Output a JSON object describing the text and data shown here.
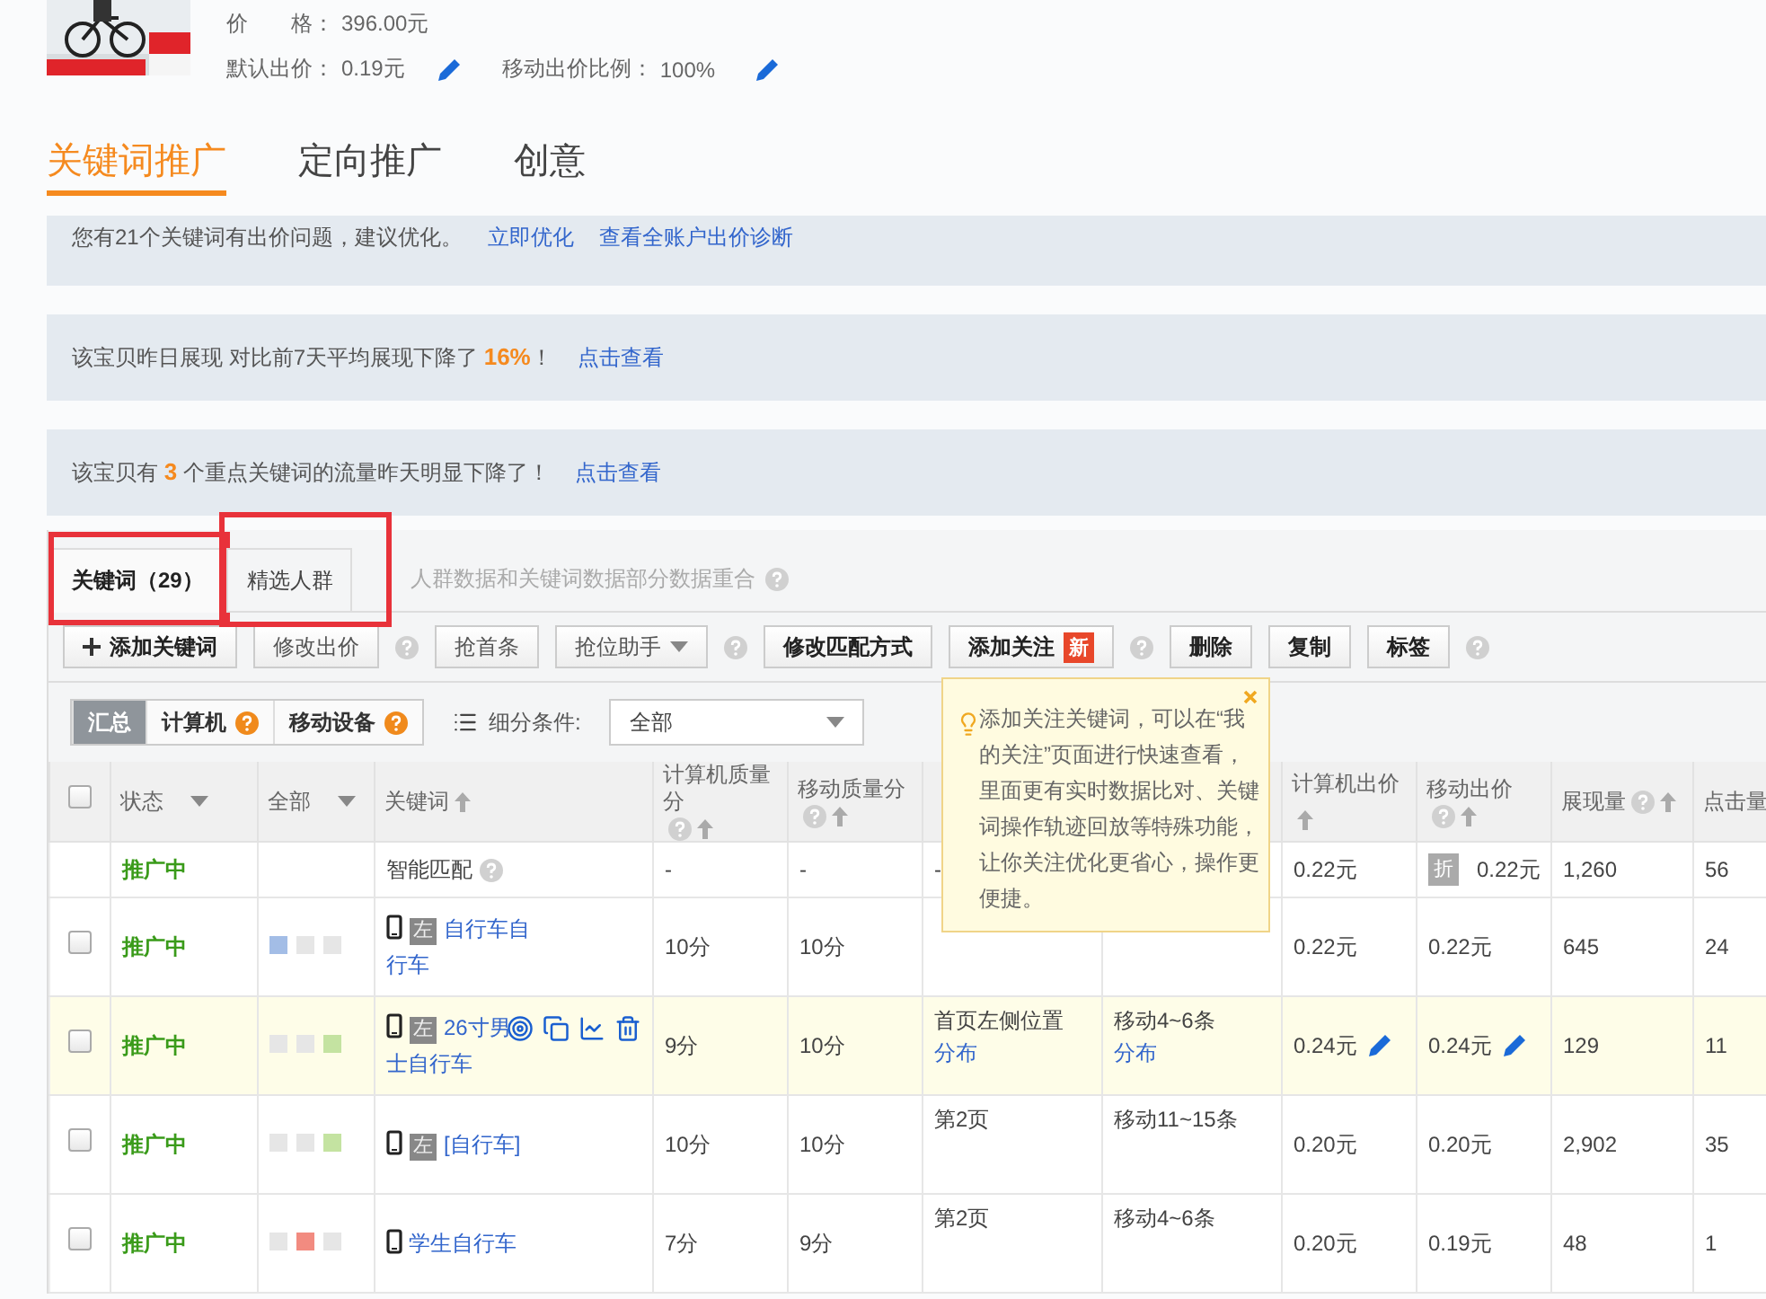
{
  "product": {
    "price_label": "价　　格：",
    "price": "396.00元",
    "default_bid_label": "默认出价：",
    "default_bid": "0.19元",
    "mobile_ratio_label": "移动出价比例：",
    "mobile_ratio": "100%"
  },
  "main_tabs": [
    {
      "label": "关键词推广",
      "selected": true
    },
    {
      "label": "定向推广",
      "selected": false
    },
    {
      "label": "创意",
      "selected": false
    }
  ],
  "notices": [
    {
      "text": "您有21个关键词有出价问题，建议优化。",
      "links": [
        "立即优化",
        "查看全账户出价诊断"
      ]
    },
    {
      "text": "该宝贝昨日展现 对比前7天平均展现下降了 **16%**！",
      "links": [
        "点击查看"
      ]
    },
    {
      "text": "该宝贝有 **3** 个重点关键词的流量昨天明显下降了！",
      "links": [
        "点击查看"
      ]
    }
  ],
  "sub_tabs": [
    {
      "label": "关键词（29）",
      "selected": true,
      "annotated": true
    },
    {
      "label": "精选人群",
      "selected": false,
      "annotated": true
    }
  ],
  "sub_note": "人群数据和关键词数据部分数据重合",
  "toolbar": [
    {
      "kind": "add",
      "label": "添加关键词"
    },
    {
      "kind": "button",
      "label": "修改出价"
    },
    {
      "kind": "help"
    },
    {
      "kind": "button",
      "label": "抢首条"
    },
    {
      "kind": "dropdown",
      "label": "抢位助手"
    },
    {
      "kind": "help"
    },
    {
      "kind": "strong",
      "label": "修改匹配方式"
    },
    {
      "kind": "badge",
      "label": "添加关注",
      "badge": "新"
    },
    {
      "kind": "help"
    },
    {
      "kind": "strong",
      "label": "删除"
    },
    {
      "kind": "strong",
      "label": "复制"
    },
    {
      "kind": "strong",
      "label": "标签"
    },
    {
      "kind": "help"
    }
  ],
  "tooltip": {
    "text": "添加关注关键词，可以在“我的关注”页面进行快速查看，里面更有实时数据比对、关键词操作轨迹回放等特殊功能，让你关注优化更省心，操作更便捷。"
  },
  "segments": [
    {
      "label": "汇总",
      "selected": true,
      "help": false
    },
    {
      "label": "计算机",
      "selected": false,
      "help": true
    },
    {
      "label": "移动设备",
      "selected": false,
      "help": true
    }
  ],
  "condition": {
    "label": "细分条件:",
    "value": "全部"
  },
  "table": {
    "header_checkbox": {
      "checked": false
    },
    "columns": [
      {
        "label": "状态",
        "kind": "dropdown"
      },
      {
        "label": "全部",
        "kind": "dropdown"
      },
      {
        "label": "关键词",
        "kind": "sort"
      },
      {
        "label": "计算机质量分",
        "kind": "help_sort"
      },
      {
        "label": "移动质量分",
        "kind": "help_sort"
      },
      {
        "kind": "blank"
      },
      {
        "kind": "blank"
      },
      {
        "label": "计算机出价",
        "kind": "sort"
      },
      {
        "label": "移动出价",
        "kind": "help_sort"
      },
      {
        "label": "展现量",
        "kind": "help_sort_inline"
      },
      {
        "label": "点击量",
        "kind": "plain"
      }
    ],
    "rows": [
      {
        "kind": "smart",
        "status": "推广中",
        "keyword": "智能匹配",
        "pc_quality": "-",
        "mobile_quality": "-",
        "pc_rank": "-",
        "pc_bid": "0.22元",
        "mobile_bid": "0.22元",
        "discount_badge": "折",
        "impressions": "1,260",
        "clicks": "56"
      },
      {
        "kind": "keyword",
        "checked": false,
        "hovered": false,
        "status": "推广中",
        "squares": [
          {
            "color": "#a3bde6"
          },
          {
            "color": "#e6e6e6"
          },
          {
            "color": "#e6e6e6"
          }
        ],
        "position_badge": "左",
        "keyword": "自行车自行车",
        "pc_quality": "10分",
        "mobile_quality": "10分",
        "pc_bid": "0.22元",
        "mobile_bid": "0.22元",
        "impressions": "645",
        "clicks": "24"
      },
      {
        "kind": "keyword",
        "checked": false,
        "hovered": true,
        "status": "推广中",
        "squares": [
          {
            "color": "#e6e6e6"
          },
          {
            "color": "#e6e6e6"
          },
          {
            "color": "#c4e3a1"
          }
        ],
        "position_badge": "左",
        "keyword": "26寸男士自行车",
        "pc_quality": "9分",
        "mobile_quality": "10分",
        "pc_rank": "首页左侧位置",
        "pc_rank_link": "分布",
        "mobile_rank": "移动4~6条",
        "mobile_rank_link": "分布",
        "pc_bid": "0.24元",
        "mobile_bid": "0.24元",
        "impressions": "129",
        "clicks": "11"
      },
      {
        "kind": "keyword",
        "checked": false,
        "hovered": false,
        "status": "推广中",
        "squares": [
          {
            "color": "#e6e6e6"
          },
          {
            "color": "#e6e6e6"
          },
          {
            "color": "#c4e3a1"
          }
        ],
        "position_badge": "左",
        "keyword": "[自行车]",
        "pc_quality": "10分",
        "mobile_quality": "10分",
        "pc_rank": "第2页",
        "mobile_rank": "移动11~15条",
        "pc_bid": "0.20元",
        "mobile_bid": "0.20元",
        "impressions": "2,902",
        "clicks": "35"
      },
      {
        "kind": "keyword",
        "checked": false,
        "hovered": false,
        "status": "推广中",
        "squares": [
          {
            "color": "#e6e6e6"
          },
          {
            "color": "#f28b80"
          },
          {
            "color": "#e6e6e6"
          }
        ],
        "keyword": "学生自行车",
        "pc_quality": "7分",
        "mobile_quality": "9分",
        "pc_rank": "第2页",
        "mobile_rank": "移动4~6条",
        "pc_bid": "0.20元",
        "mobile_bid": "0.19元",
        "impressions": "48",
        "clicks": "1"
      }
    ]
  }
}
